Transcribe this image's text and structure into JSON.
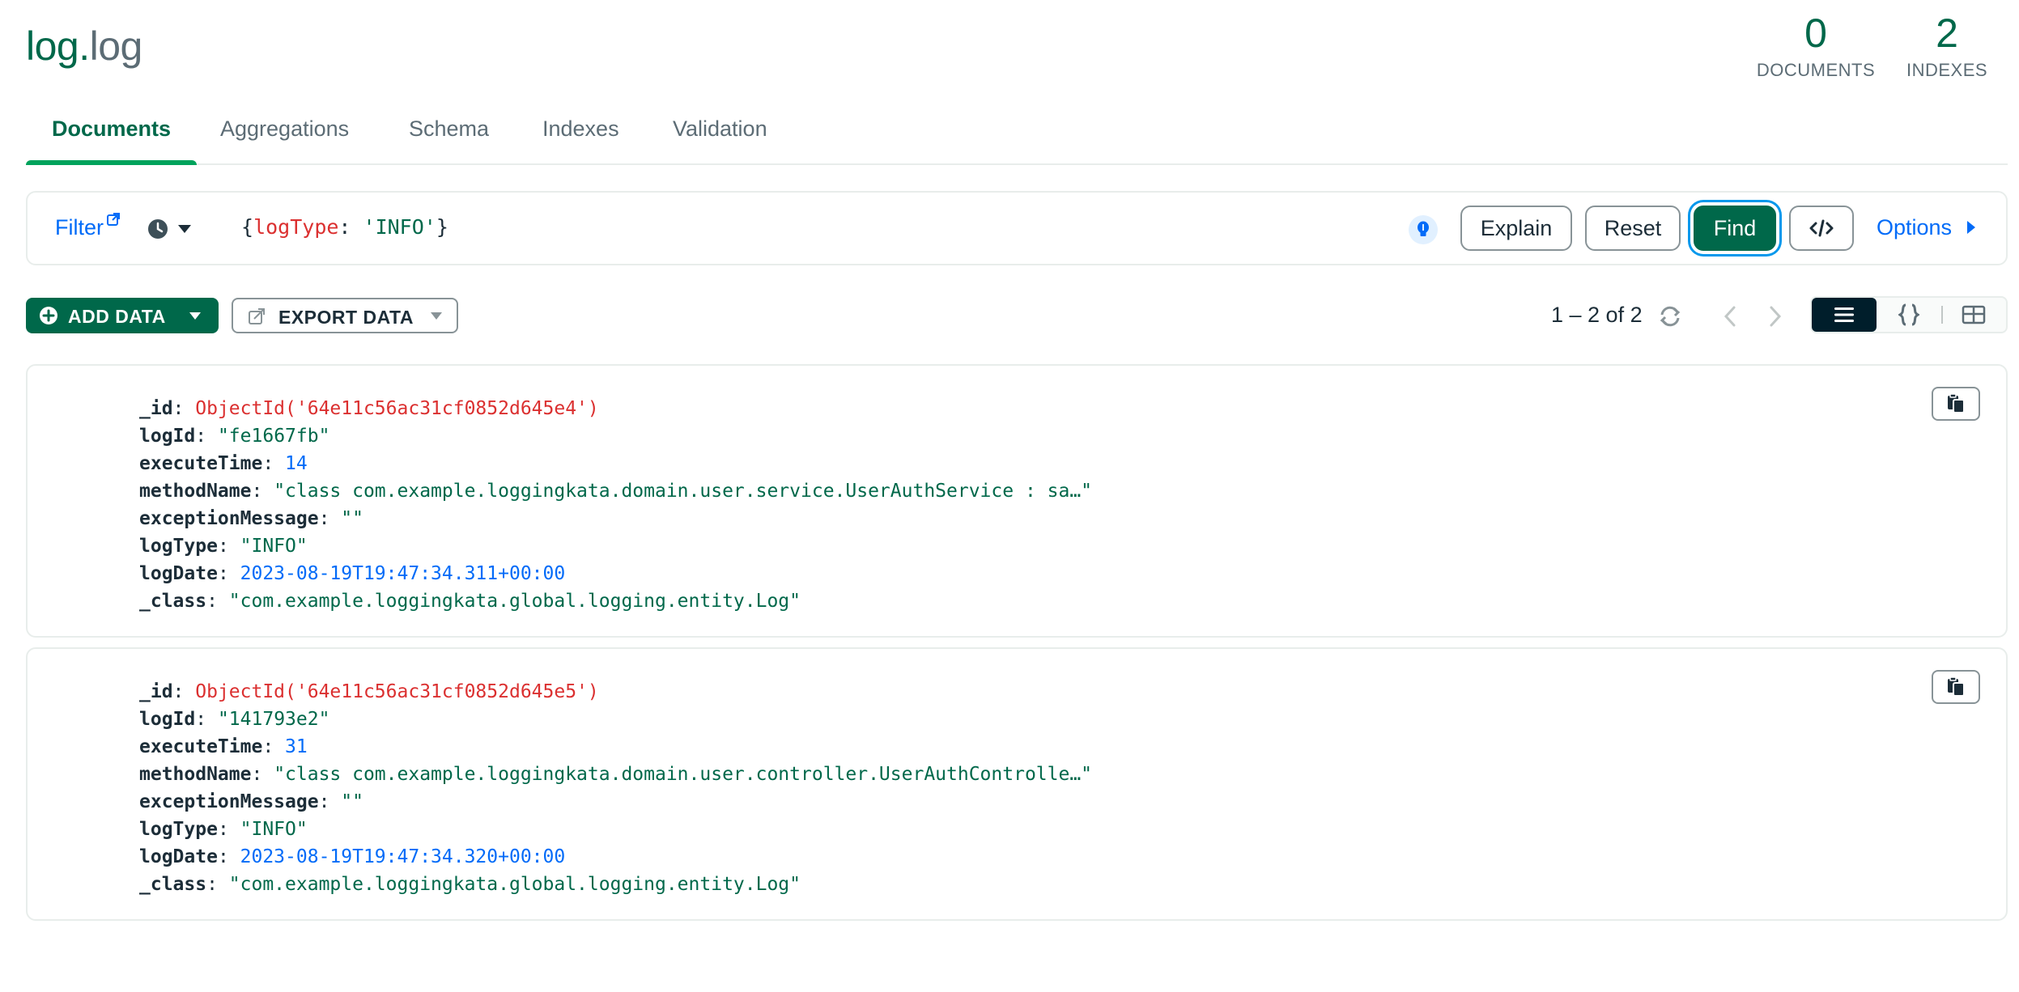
{
  "header": {
    "db_name": "log",
    "separator": ".",
    "collection_name": "log",
    "documents_count": "0",
    "documents_label": "DOCUMENTS",
    "indexes_count": "2",
    "indexes_label": "INDEXES"
  },
  "tabs": [
    {
      "label": "Documents",
      "active": true
    },
    {
      "label": "Aggregations"
    },
    {
      "label": "Schema"
    },
    {
      "label": "Indexes"
    },
    {
      "label": "Validation"
    }
  ],
  "query_bar": {
    "filter_label": "Filter",
    "query_open": "{",
    "query_key": "logType",
    "query_sep": ": ",
    "query_value": "'INFO'",
    "query_close": "}",
    "explain_label": "Explain",
    "reset_label": "Reset",
    "find_label": "Find",
    "options_label": "Options"
  },
  "toolbar": {
    "add_data_label": "ADD DATA",
    "export_data_label": "EXPORT DATA",
    "pagination": "1 – 2 of 2"
  },
  "documents": [
    {
      "_id": "ObjectId('64e11c56ac31cf0852d645e4')",
      "logId": "\"fe1667fb\"",
      "executeTime": "14",
      "methodName": "\"class com.example.loggingkata.domain.user.service.UserAuthService : sa…\"",
      "exceptionMessage": "\"\"",
      "logType": "\"INFO\"",
      "logDate": "2023-08-19T19:47:34.311+00:00",
      "_class": "\"com.example.loggingkata.global.logging.entity.Log\""
    },
    {
      "_id": "ObjectId('64e11c56ac31cf0852d645e5')",
      "logId": "\"141793e2\"",
      "executeTime": "31",
      "methodName": "\"class com.example.loggingkata.domain.user.controller.UserAuthControlle…\"",
      "exceptionMessage": "\"\"",
      "logType": "\"INFO\"",
      "logDate": "2023-08-19T19:47:34.320+00:00",
      "_class": "\"com.example.loggingkata.global.logging.entity.Log\""
    }
  ],
  "field_keys": {
    "_id": "_id",
    "logId": "logId",
    "executeTime": "executeTime",
    "methodName": "methodName",
    "exceptionMessage": "exceptionMessage",
    "logType": "logType",
    "logDate": "logDate",
    "_class": "_class"
  },
  "colors": {
    "brand_green": "#00684a",
    "link_blue": "#016bf8",
    "key_red": "#db3030"
  }
}
